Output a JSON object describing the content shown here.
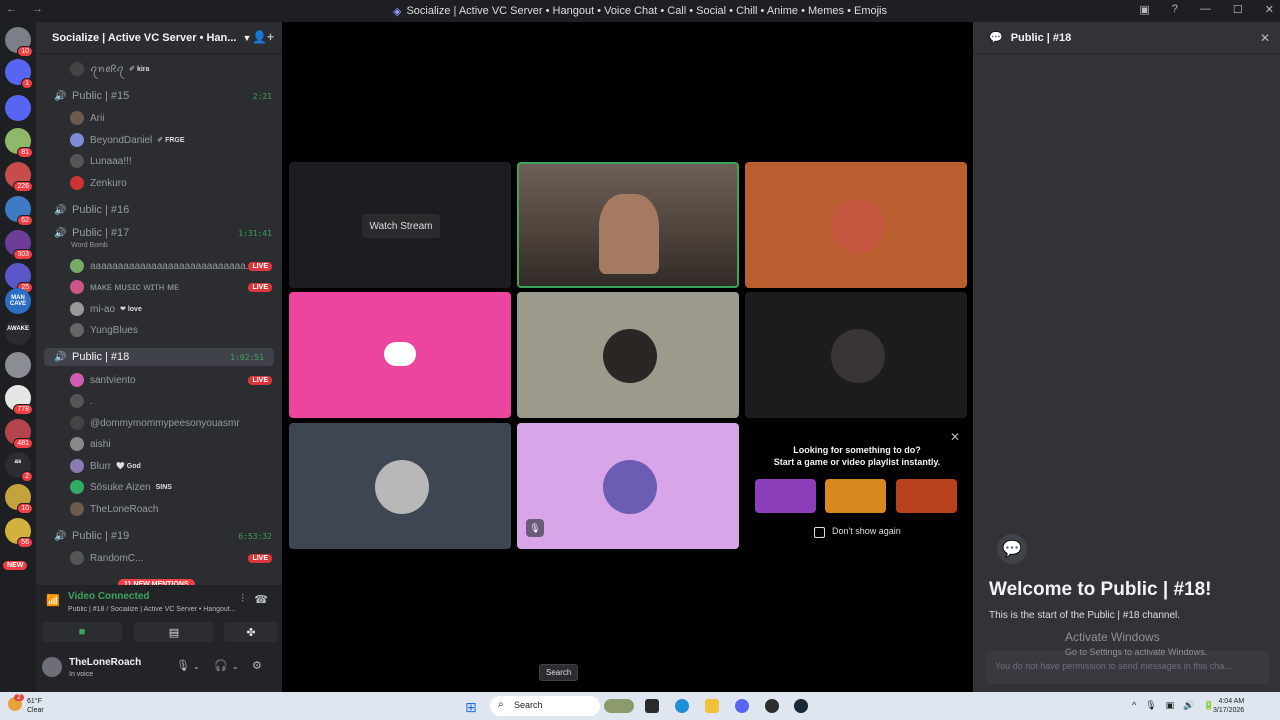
{
  "window": {
    "title": "Socialize | Active VC Server • Hangout • Voice Chat • Call • Social • Chill • Anime • Memes • Emojis"
  },
  "servers": [
    {
      "badge": "10",
      "color": "#7a7f88"
    },
    {
      "badge": "1",
      "color": "#5865f2"
    },
    {
      "badge": "",
      "color": "#5865f2"
    },
    {
      "badge": "81",
      "color": "#8fb86a"
    },
    {
      "badge": "226",
      "color": "#c94c4c"
    },
    {
      "badge": "62",
      "color": "#3e7bc4"
    },
    {
      "badge": "303",
      "color": "#6c3e9a"
    },
    {
      "badge": "25",
      "color": "#5b57c9"
    },
    {
      "badge": "",
      "color": "#2b6ec4",
      "label": "MAN CAVE"
    },
    {
      "badge": "",
      "color": "#2a2b2f",
      "label": "AWAKE"
    },
    {
      "badge": "",
      "color": "#8a8d93"
    },
    {
      "badge": "778",
      "color": "#e6e6e6"
    },
    {
      "badge": "481",
      "color": "#b5454d"
    },
    {
      "badge": "2",
      "color": "#2b2d31",
      "label": "as"
    },
    {
      "badge": "10",
      "color": "#c4a23c"
    },
    {
      "badge": "56",
      "color": "#d1b23d"
    }
  ],
  "server_new": "NEW",
  "server": {
    "name": "Socialize | Active VC Server • Han..."
  },
  "channels": {
    "top_user": {
      "name": "ꪖꪀꫀᖇꪖ",
      "tag": "✐ kira"
    },
    "c15": {
      "name": "Public | #15",
      "timer": "2:21",
      "users": [
        {
          "name": "Arii"
        },
        {
          "name": "BeyondDaniel",
          "tag": "✐ FRGE"
        },
        {
          "name": "Lunaaa!!!"
        },
        {
          "name": "Zenkuro"
        }
      ]
    },
    "c16": {
      "name": "Public | #16"
    },
    "c17": {
      "name": "Public | #17",
      "timer": "1:31:41",
      "subtitle": "Word Bomb",
      "users": [
        {
          "name": "aaaaaaaaaaaaaaaaaaaaaaaaaaaa...",
          "live": "LIVE"
        },
        {
          "name": "ᴍᴀᴋᴇ ᴍᴜꜱɪᴄ ᴡɪᴛʜ ᴍᴇ",
          "live": "LIVE"
        },
        {
          "name": "mi-ao",
          "tag": "❤ love"
        },
        {
          "name": "YungBlues"
        }
      ]
    },
    "c18": {
      "name": "Public | #18",
      "timer": "1:02:51",
      "users": [
        {
          "name": "santviento",
          "live": "LIVE"
        },
        {
          "name": "."
        },
        {
          "name": "@dommymommypeesonyouasmr"
        },
        {
          "name": "aishi"
        },
        {
          "name": "Blurr",
          "tag": "🤍 God"
        },
        {
          "name": "Sōsuke Aizen",
          "tag": "SINS"
        },
        {
          "name": "TheLoneRoach"
        }
      ]
    },
    "c19": {
      "name": "Public | #19",
      "timer": "6:53:32",
      "users": [
        {
          "name": "RandomC...",
          "live": "LIVE"
        }
      ]
    },
    "mentions": "11 NEW MENTIONS"
  },
  "voice": {
    "status": "Video Connected",
    "location": "Public | #18 / Socialize | Active VC Server • Hangout..."
  },
  "user": {
    "name": "TheLoneRoach",
    "status": "In voice"
  },
  "stage": {
    "watch_label": "Watch Stream"
  },
  "activity": {
    "line1": "Looking for something to do?",
    "line2": "Start a game or video playlist instantly.",
    "checkbox_label": "Don't show again"
  },
  "chat": {
    "channel": "Public | #18",
    "welcome": "Welcome to Public | #18!",
    "start": "This is the start of the Public | #18 channel.",
    "activate1": "Activate Windows",
    "activate2": "Go to Settings to activate Windows.",
    "input_placeholder": "You do not have permission to send messages in this cha..."
  },
  "tooltip": {
    "search": "Search"
  },
  "taskbar": {
    "weather_temp": "61°F",
    "weather_cond": "Clear",
    "weather_badge": "2",
    "search": "Search",
    "time": "4:04 AM",
    "date": "3/17/2026"
  }
}
